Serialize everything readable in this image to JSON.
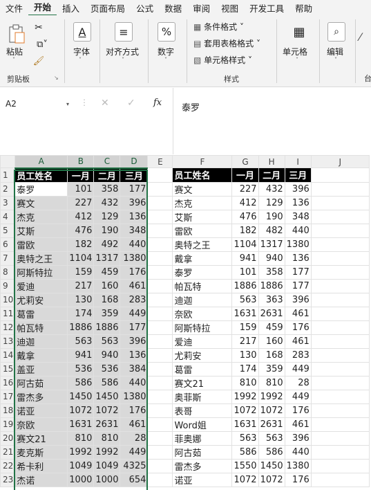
{
  "menu": [
    "文件",
    "开始",
    "插入",
    "页面布局",
    "公式",
    "数据",
    "审阅",
    "视图",
    "开发工具",
    "帮助"
  ],
  "menu_active_index": 1,
  "ribbon": {
    "clipboard": {
      "paste": "粘贴",
      "group": "剪贴板"
    },
    "font": {
      "label": "字体"
    },
    "align": {
      "label": "对齐方式"
    },
    "number": {
      "label": "数字",
      "symbol": "%"
    },
    "styles": {
      "cond": "条件格式 ˅",
      "table": "套用表格格式 ˅",
      "cell": "单元格样式 ˅",
      "group": "样式"
    },
    "cells": {
      "label": "单元格"
    },
    "edit": {
      "label": "编辑"
    },
    "more": "台"
  },
  "formula": {
    "namebox": "A2",
    "fx": "fx",
    "value": "泰罗"
  },
  "columns": [
    "A",
    "B",
    "C",
    "D",
    "E",
    "F",
    "G",
    "H",
    "I",
    "J"
  ],
  "left_table": {
    "header": [
      "员工姓名",
      "一月",
      "二月",
      "三月"
    ],
    "rows": [
      [
        "泰罗",
        "101",
        "358",
        "177"
      ],
      [
        "赛文",
        "227",
        "432",
        "396"
      ],
      [
        "杰克",
        "412",
        "129",
        "136"
      ],
      [
        "艾斯",
        "476",
        "190",
        "348"
      ],
      [
        "雷欧",
        "182",
        "492",
        "440"
      ],
      [
        "奥特之王",
        "1104",
        "1317",
        "1380"
      ],
      [
        "阿斯特拉",
        "159",
        "459",
        "176"
      ],
      [
        "爱迪",
        "217",
        "160",
        "461"
      ],
      [
        "尤莉安",
        "130",
        "168",
        "283"
      ],
      [
        "葛雷",
        "174",
        "359",
        "449"
      ],
      [
        "帕瓦特",
        "1886",
        "1886",
        "177"
      ],
      [
        "迪迦",
        "563",
        "563",
        "396"
      ],
      [
        "戴拿",
        "941",
        "940",
        "136"
      ],
      [
        "盖亚",
        "536",
        "536",
        "384"
      ],
      [
        "阿古茹",
        "586",
        "586",
        "440"
      ],
      [
        "雷杰多",
        "1450",
        "1450",
        "1380"
      ],
      [
        "诺亚",
        "1072",
        "1072",
        "176"
      ],
      [
        "奈欧",
        "1631",
        "2631",
        "461"
      ],
      [
        "赛文21",
        "810",
        "810",
        "28"
      ],
      [
        "麦克斯",
        "1992",
        "1992",
        "449"
      ],
      [
        "希卡利",
        "1049",
        "1049",
        "4325"
      ],
      [
        "杰诺",
        "1000",
        "1000",
        "654"
      ]
    ]
  },
  "right_table": {
    "header": [
      "员工姓名",
      "一月",
      "二月",
      "三月"
    ],
    "rows": [
      [
        "赛文",
        "227",
        "432",
        "396"
      ],
      [
        "杰克",
        "412",
        "129",
        "136"
      ],
      [
        "艾斯",
        "476",
        "190",
        "348"
      ],
      [
        "雷欧",
        "182",
        "482",
        "440"
      ],
      [
        "奥特之王",
        "1104",
        "1317",
        "1380"
      ],
      [
        "戴拿",
        "941",
        "940",
        "136"
      ],
      [
        "泰罗",
        "101",
        "358",
        "177"
      ],
      [
        "帕瓦特",
        "1886",
        "1886",
        "177"
      ],
      [
        "迪迦",
        "563",
        "363",
        "396"
      ],
      [
        "奈欧",
        "1631",
        "2631",
        "461"
      ],
      [
        "阿斯特拉",
        "159",
        "459",
        "176"
      ],
      [
        "爱迪",
        "217",
        "160",
        "461"
      ],
      [
        "尤莉安",
        "130",
        "168",
        "283"
      ],
      [
        "葛雷",
        "174",
        "359",
        "449"
      ],
      [
        "赛文21",
        "810",
        "810",
        "28"
      ],
      [
        "奥菲斯",
        "1992",
        "1992",
        "449"
      ],
      [
        "表哥",
        "1072",
        "1072",
        "176"
      ],
      [
        "Word姐",
        "1631",
        "2631",
        "461"
      ],
      [
        "菲奥娜",
        "563",
        "563",
        "396"
      ],
      [
        "阿古茹",
        "586",
        "586",
        "440"
      ],
      [
        "雷杰多",
        "1550",
        "1450",
        "1380"
      ],
      [
        "诺亚",
        "1072",
        "1072",
        "176"
      ]
    ]
  },
  "colors": {
    "accent": "#217346",
    "header_bg": "#000000",
    "selection": "#d9d9d9"
  }
}
